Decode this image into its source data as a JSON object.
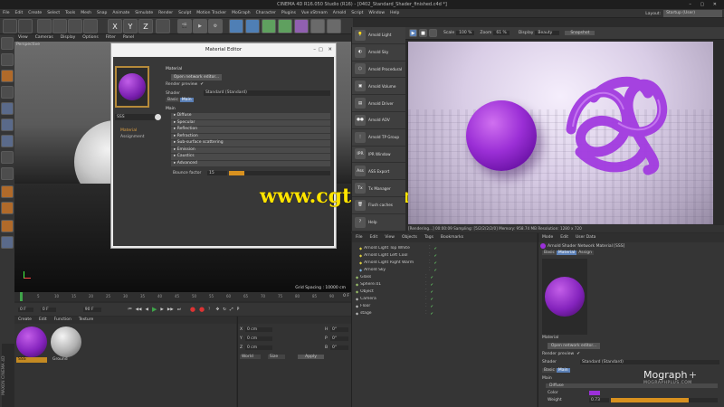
{
  "window": {
    "title": "CINEMA 4D R16.050 Studio (R16) - [0402_Standard_Shader_finished.c4d *]"
  },
  "menubar": [
    "File",
    "Edit",
    "Create",
    "Select",
    "Tools",
    "Mesh",
    "Snap",
    "Animate",
    "Simulate",
    "Render",
    "Sculpt",
    "Motion Tracker",
    "MoGraph",
    "Character",
    "Plugins",
    "Vue xStream",
    "Arnold",
    "Script",
    "Window",
    "Help"
  ],
  "layout": {
    "label": "Layout:",
    "value": "Startup (User)"
  },
  "viewport": {
    "menu": [
      "View",
      "Cameras",
      "Display",
      "Options",
      "Filter",
      "Panel"
    ],
    "label": "Perspective",
    "grid_spacing": "Grid Spacing : 10000 cm"
  },
  "material_editor": {
    "title": "Material Editor",
    "section": "Material",
    "network_button": "Open network editor...",
    "render_preview": "Render preview",
    "shader_label": "Shader",
    "shader_value": "Standard (Standard)",
    "tabs": [
      "Basic",
      "Main"
    ],
    "main_header": "Main",
    "name": "SSS",
    "left_items": [
      "Material",
      "Assignment"
    ],
    "sections": [
      "Diffuse",
      "Specular",
      "Reflection",
      "Refraction",
      "Sub-surface scattering",
      "Emission",
      "Caustics",
      "Advanced"
    ],
    "bounce_label": "Bounce factor",
    "bounce_value": "15",
    "bounce_fraction": 0.15
  },
  "arnold_menu": [
    "Arnold Light",
    "Arnold Sky",
    "Arnold Procedural",
    "Arnold Volume",
    "Arnold Driver",
    "Arnold AOV",
    "Arnold TP Group",
    "IPR Window",
    "ASS Export",
    "Tx Manager",
    "Flush caches",
    "Help"
  ],
  "render_view": {
    "scale_label": "Scale",
    "scale_value": "100 %",
    "zoom_label": "Zoom",
    "zoom_value": "61 %",
    "display_label": "Display",
    "display_value": "Beauty",
    "snapshot": "Snapshot",
    "status": "[Rendering...]   00:00:09   Sampling: [5/2/2/2/2/0]   Memory: 958.74 MB   Resolution: 1280 x 720"
  },
  "timeline": {
    "start": "0 F",
    "end": "90 F",
    "frame": "0 F",
    "ticks": [
      "0",
      "5",
      "10",
      "15",
      "20",
      "25",
      "30",
      "35",
      "40",
      "45",
      "50",
      "55",
      "60",
      "65",
      "70",
      "75",
      "80",
      "85",
      "90"
    ],
    "current": "0 F"
  },
  "material_manager": {
    "menu": [
      "Create",
      "Edit",
      "Function",
      "Texture"
    ],
    "materials": [
      "SSS",
      "Ground"
    ]
  },
  "coordinates": {
    "x": "0 cm",
    "y": "0 cm",
    "z": "0 cm",
    "h": "0°",
    "p": "0°",
    "b": "0°",
    "mode1": "World",
    "mode2": "Size",
    "apply": "Apply"
  },
  "object_manager": {
    "menu": [
      "File",
      "Edit",
      "View",
      "Objects",
      "Tags",
      "Bookmarks"
    ],
    "objects": [
      "Arnold Light Top White",
      "Arnold Light Left Cool",
      "Arnold Light Right Warm",
      "Arnold Sky",
      "Glass",
      "Sphere.01",
      "Object",
      "Camera",
      "Floor",
      "stage"
    ]
  },
  "attributes": {
    "menu": [
      "Mode",
      "Edit",
      "User Data"
    ],
    "title": "Arnold Shader Network Material [SSS]",
    "tabs": [
      "Basic",
      "Material",
      "Assign"
    ],
    "section": "Material",
    "network_button": "Open network editor...",
    "render_preview": "Render preview",
    "shader_label": "Shader",
    "shader_value": "Standard (Standard)",
    "sub_tabs": [
      "Basic",
      "Main"
    ],
    "main": "Main",
    "diffuse": "Diffuse",
    "color_label": "Color",
    "weight_label": "Weight",
    "weight_value": "0.73",
    "weight_fraction": 0.73
  },
  "watermark": {
    "text": "www.cgtsj.com"
  },
  "mograph_logo": {
    "title": "Mograph",
    "plus": "+",
    "sub": "MOGRAPHPLUS.COM"
  },
  "side_logo": {
    "line1": "MAXON",
    "line2": "CINEMA 4D"
  },
  "colors": {
    "accent": "#8a2be2",
    "purple": "#9b30d9",
    "orange": "#e08a1e",
    "yellow": "#ffe000",
    "panel": "#3a3a3a"
  }
}
